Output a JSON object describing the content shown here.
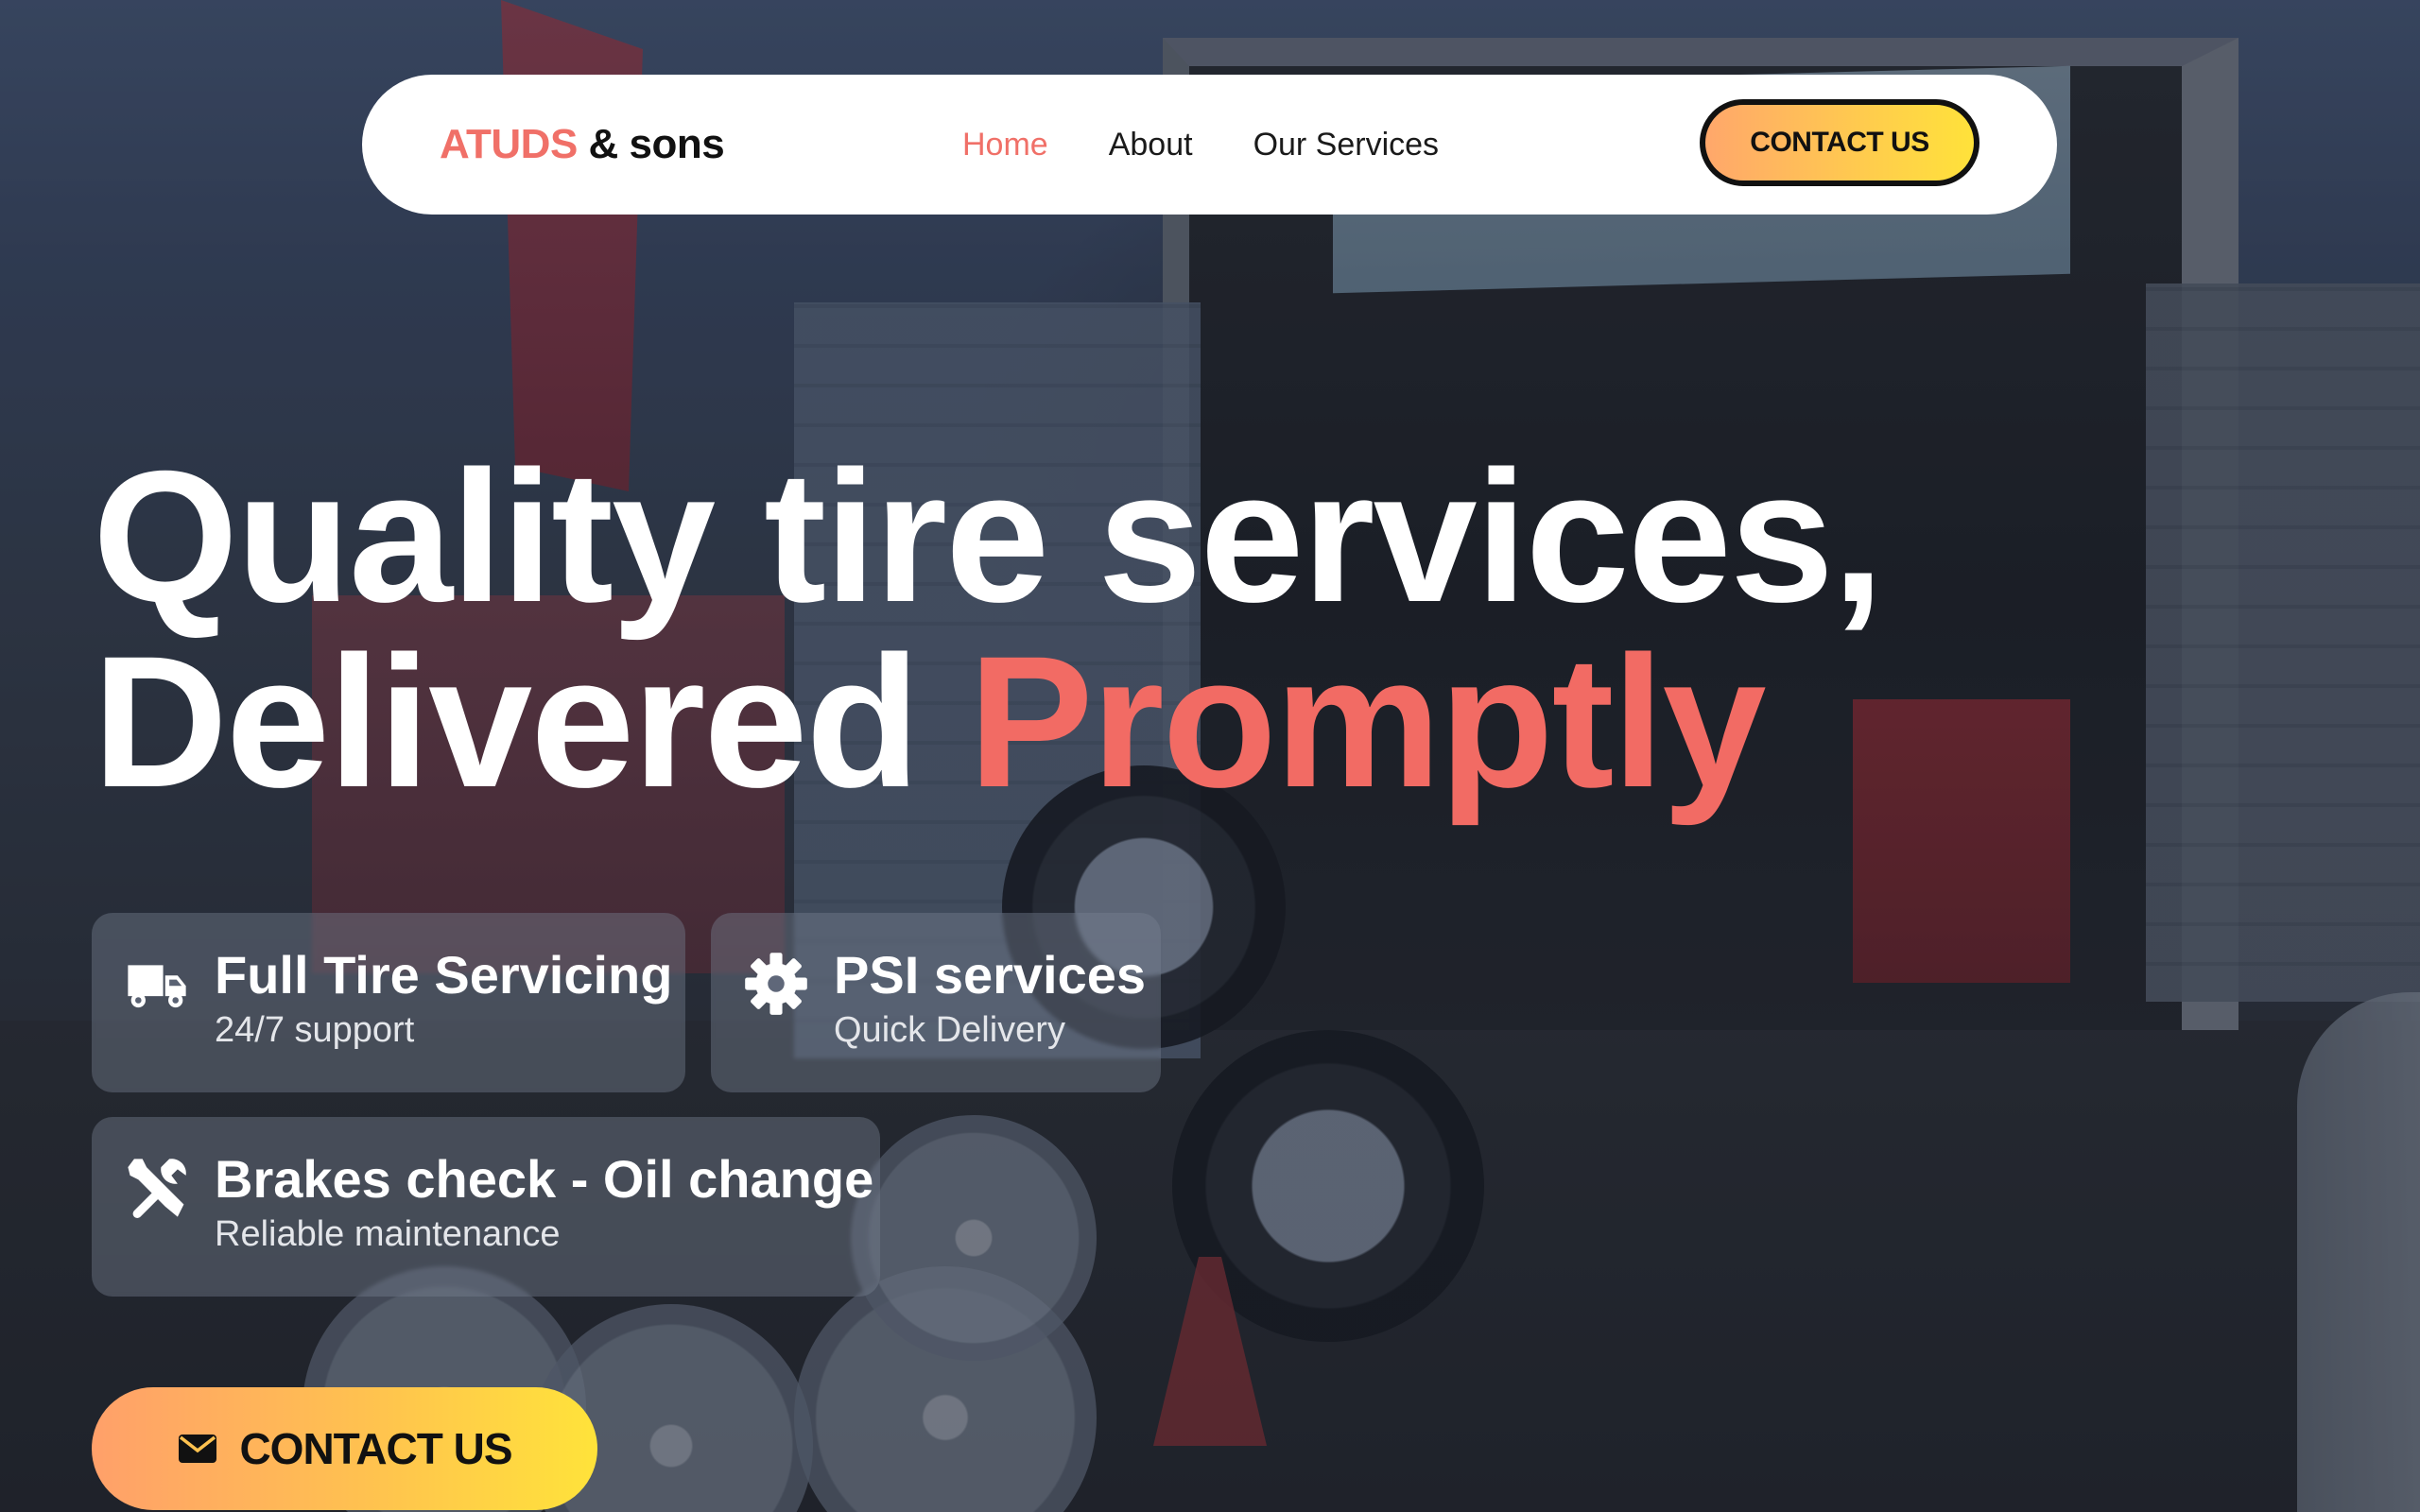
{
  "brand": {
    "name": "ATUDS",
    "suffix": "& sons",
    "accent_color": "#f07068"
  },
  "nav": {
    "links": [
      {
        "label": "Home",
        "active": true
      },
      {
        "label": "About",
        "active": false
      },
      {
        "label": "Our Services",
        "active": false
      }
    ],
    "contact_label": "CONTACT US"
  },
  "hero": {
    "headline_line1": "Quality tire services,",
    "headline_line2_plain": "Delivered",
    "headline_line2_accent": "Promptly",
    "accent_color": "#f26b64"
  },
  "features": [
    {
      "icon": "truck-icon",
      "title": "Full Tire Servicing",
      "subtitle": "24/7 support"
    },
    {
      "icon": "gear-icon",
      "title": "PSI services",
      "subtitle": "Quick Delivery"
    },
    {
      "icon": "tools-icon",
      "title": "Brakes check - Oil change",
      "subtitle": "Reliable maintenance"
    }
  ],
  "cta": {
    "icon": "envelope-icon",
    "label": "CONTACT US"
  }
}
